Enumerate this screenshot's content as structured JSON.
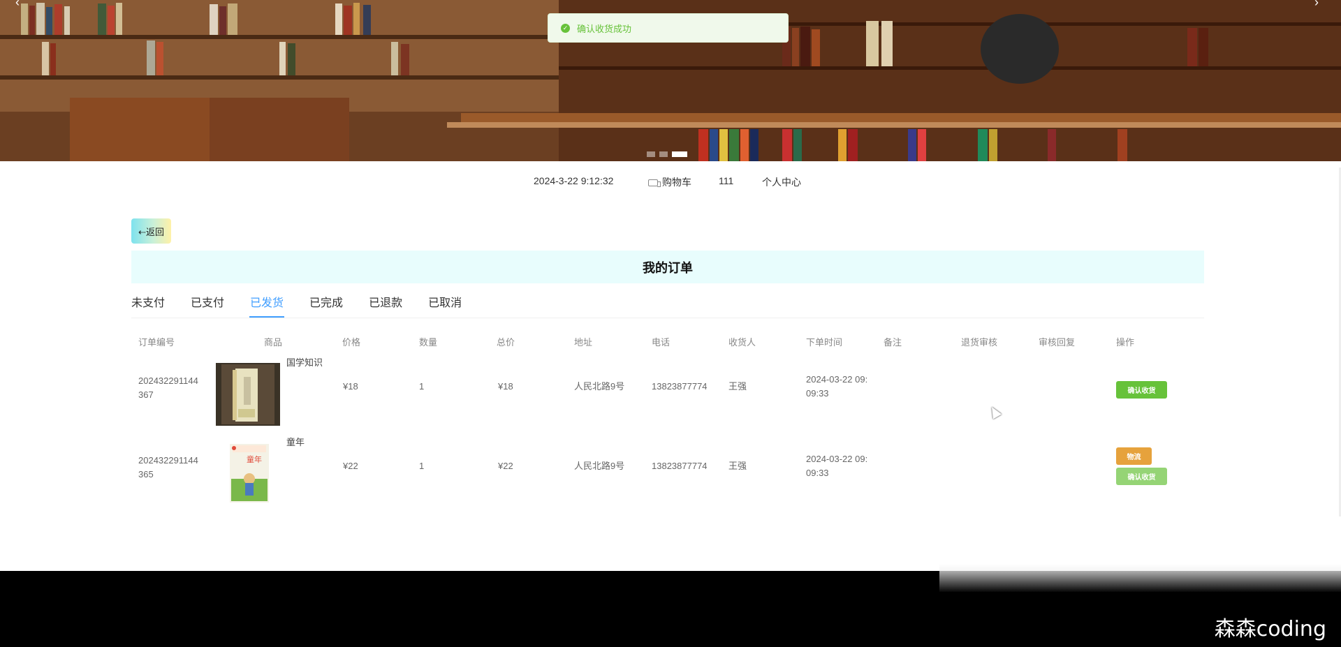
{
  "banner": {
    "prev_arrow": "‹",
    "next_arrow": "›",
    "slides": 3,
    "active_slide": 3
  },
  "toast": {
    "icon": "check-circle-icon",
    "text": "确认收货成功",
    "color": "#67c23a"
  },
  "topnav": {
    "datetime": "2024-3-22 9:12:32",
    "cart_icon": "truck-icon",
    "cart_label": "购物车",
    "username": "111",
    "profile_label": "个人中心"
  },
  "back_label": "⇠返回",
  "title": "我的订单",
  "tabs": [
    {
      "label": "未支付"
    },
    {
      "label": "已支付"
    },
    {
      "label": "已发货",
      "active": true
    },
    {
      "label": "已完成"
    },
    {
      "label": "已退款"
    },
    {
      "label": "已取消"
    }
  ],
  "table": {
    "columns": [
      "订单编号",
      "商品",
      "价格",
      "数量",
      "总价",
      "地址",
      "电话",
      "收货人",
      "下单时间",
      "备注",
      "退货审核",
      "审核回复",
      "操作"
    ],
    "rows": [
      {
        "order_no_1": "202432291144",
        "order_no_2": "367",
        "product": "国学知识",
        "price": "¥18",
        "qty": "1",
        "total": "¥18",
        "address": "人民北路9号",
        "phone": "13823877774",
        "receiver": "王强",
        "time_1": "2024-03-22 09:",
        "time_2": "09:33",
        "buttons": [
          "确认收货"
        ]
      },
      {
        "order_no_1": "202432291144",
        "order_no_2": "365",
        "product": "童年",
        "price": "¥22",
        "qty": "1",
        "total": "¥22",
        "address": "人民北路9号",
        "phone": "13823877774",
        "receiver": "王强",
        "time_1": "2024-03-22 09:",
        "time_2": "09:33",
        "buttons": [
          "物流",
          "确认收货"
        ]
      }
    ]
  },
  "watermark": "森森coding"
}
